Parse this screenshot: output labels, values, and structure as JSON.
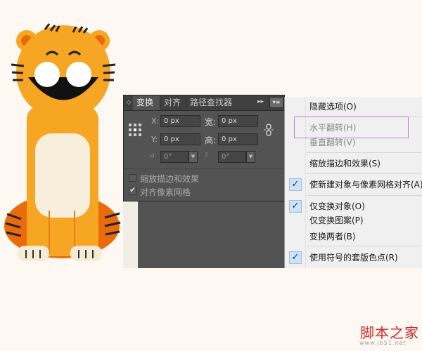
{
  "panel": {
    "tabs": [
      "变换",
      "对齐",
      "路径查找器"
    ],
    "x_label": "X:",
    "y_label": "Y:",
    "w_label": "宽:",
    "h_label": "高:",
    "x_value": "0 px",
    "y_value": "0 px",
    "w_value": "0 px",
    "h_value": "0 px",
    "rotate_value": "0°",
    "shear_value": "0°",
    "scale_strokes_label": "缩放描边和效果",
    "scale_strokes_checked": false,
    "align_pixel_label": "对齐像素网格",
    "align_pixel_checked": true
  },
  "menu": {
    "items": [
      {
        "label": "隐藏选项(O)",
        "checked": false,
        "disabled": false
      },
      {
        "label": "水平翻转(H)",
        "checked": false,
        "disabled": true
      },
      {
        "label": "垂直翻转(V)",
        "checked": false,
        "disabled": true
      },
      {
        "label": "缩放描边和效果(S)",
        "checked": false,
        "disabled": false
      },
      {
        "label": "使新建对象与像素网格对齐(A)",
        "checked": true,
        "disabled": false
      },
      {
        "label": "仅变换对象(O)",
        "checked": true,
        "disabled": false
      },
      {
        "label": "仅变换图案(P)",
        "checked": false,
        "disabled": false
      },
      {
        "label": "变换两者(B)",
        "checked": false,
        "disabled": false
      },
      {
        "label": "使用符号的套版色点(R)",
        "checked": true,
        "disabled": false
      }
    ],
    "highlight_color": "#c87ccc"
  },
  "watermark": {
    "main": "脚本之家",
    "sub": "www.jb51.net"
  },
  "colors": {
    "tiger_orange": "#f6a623",
    "tiger_dark_orange": "#ea6a0c",
    "panel_bg": "#535353",
    "menu_bg": "#f0f0f0"
  }
}
